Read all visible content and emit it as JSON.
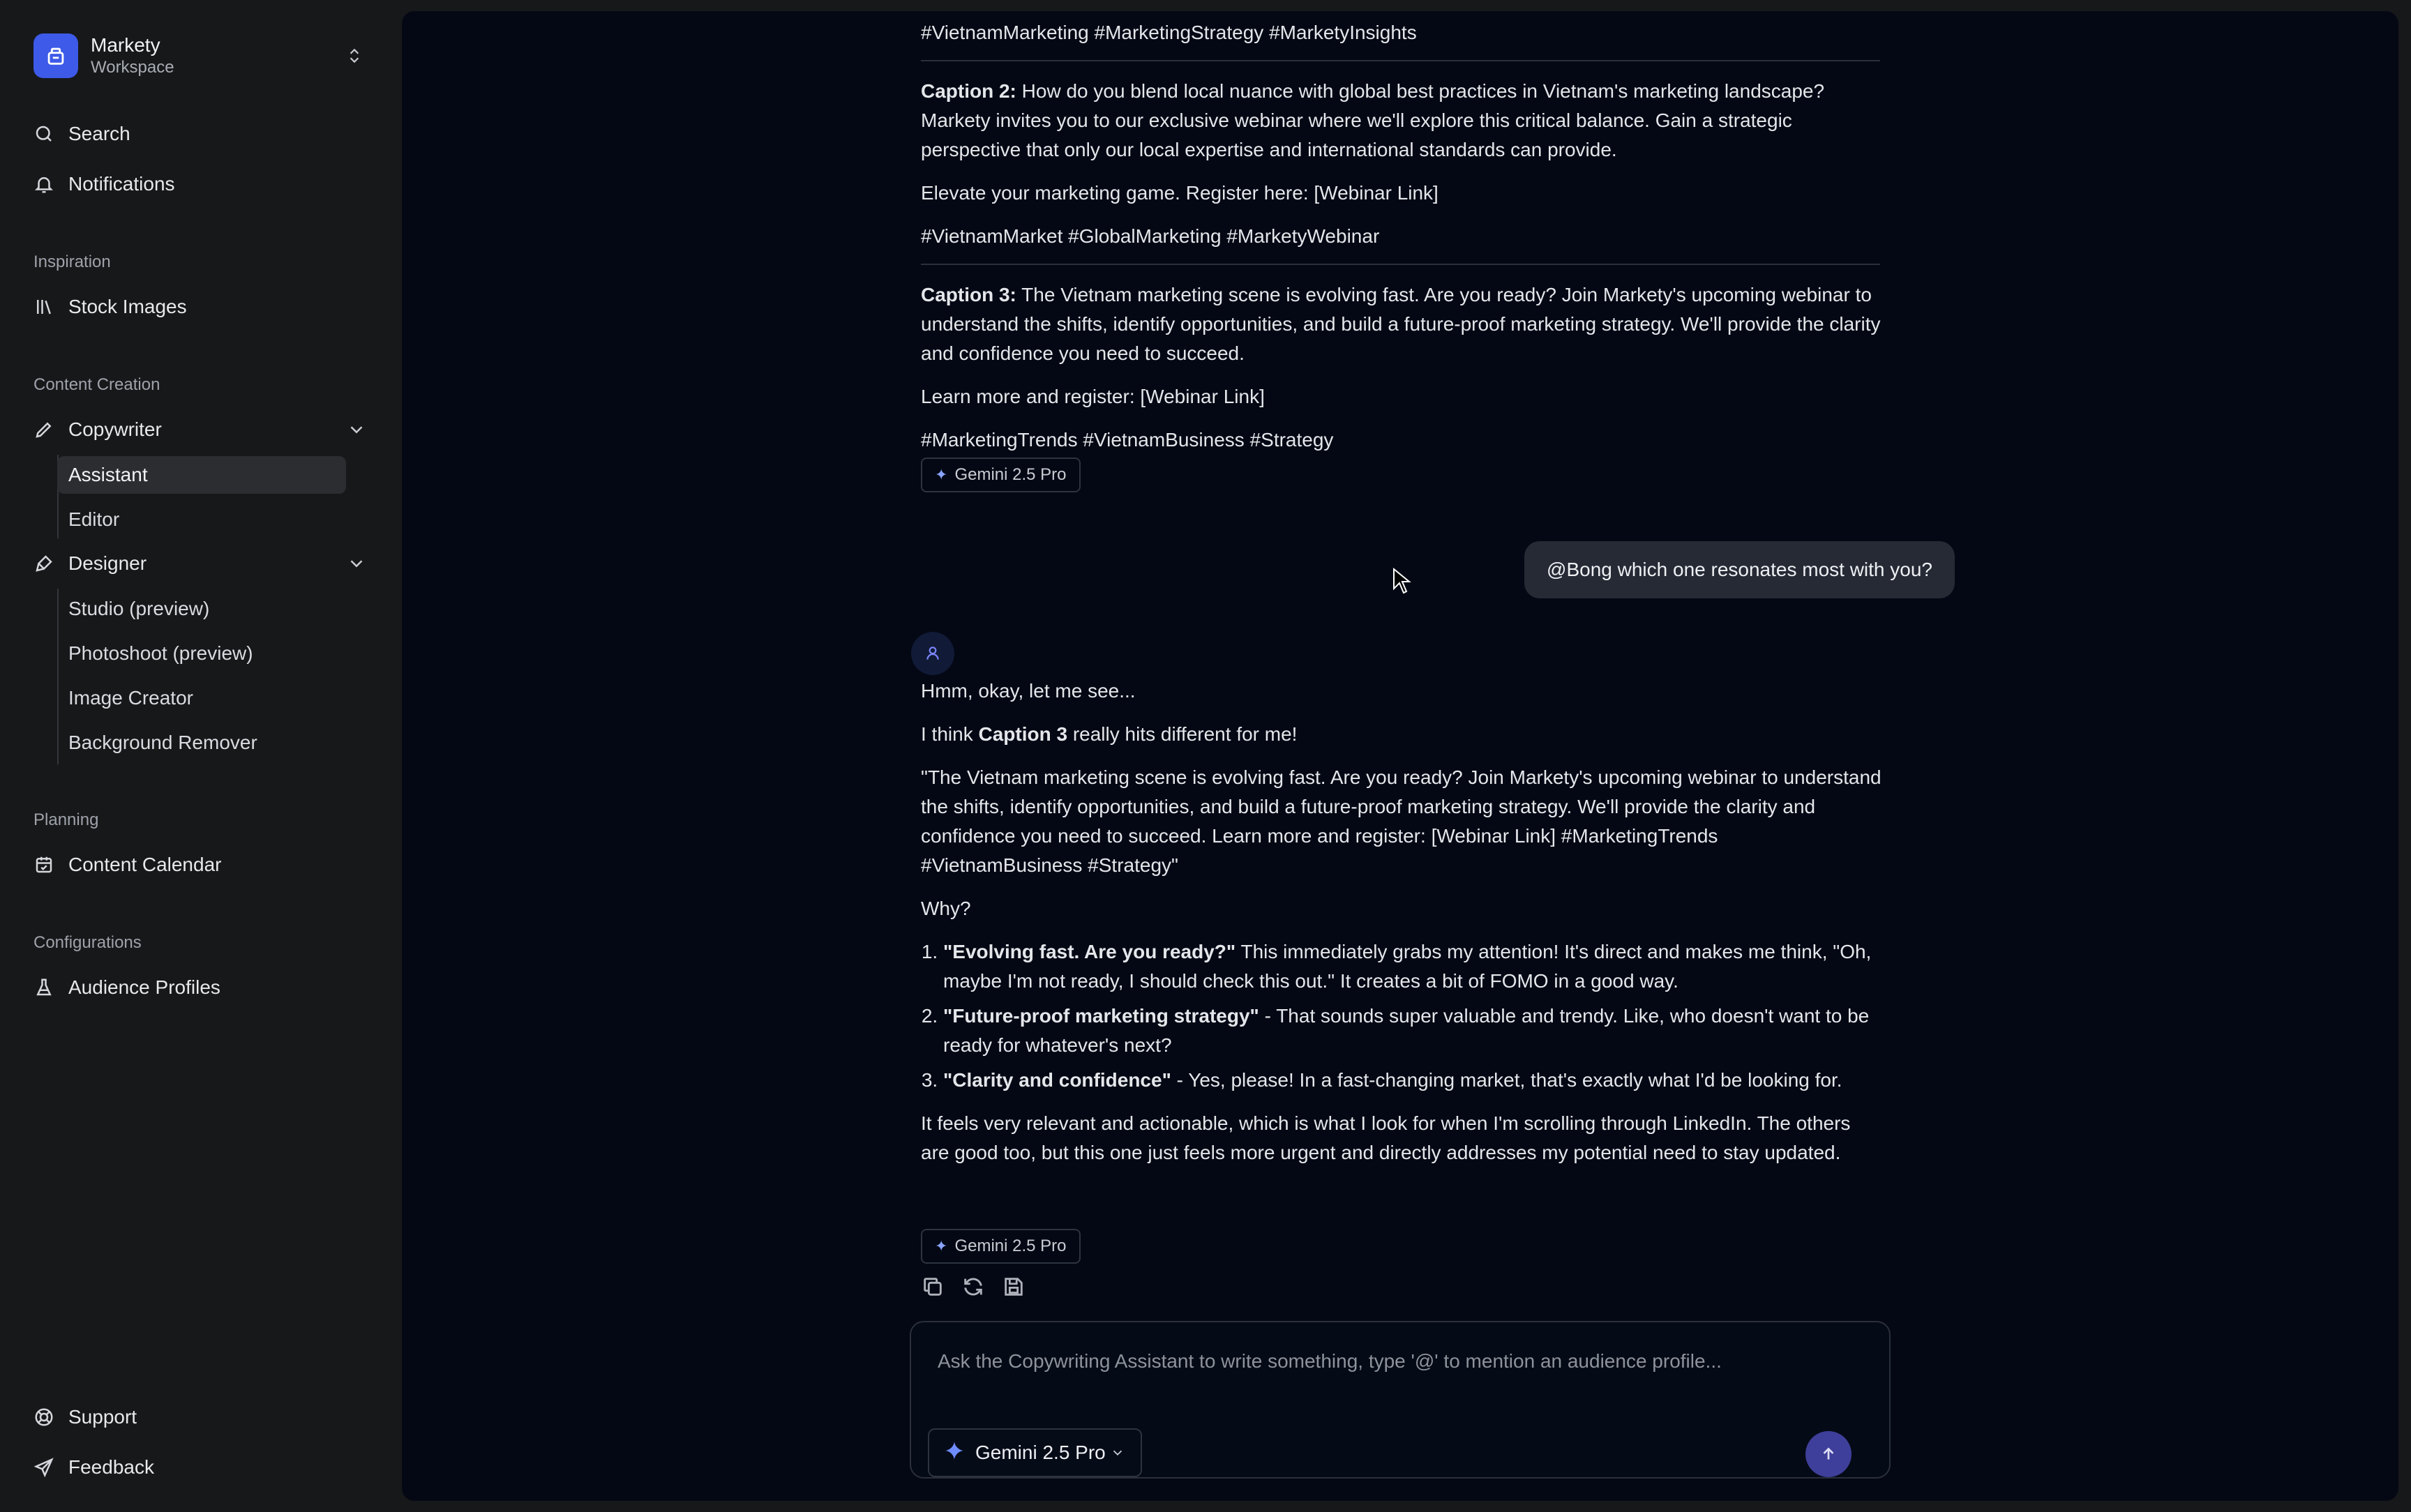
{
  "workspace": {
    "name": "Markety",
    "subtitle": "Workspace"
  },
  "nav": {
    "search": "Search",
    "notifications": "Notifications",
    "inspiration_label": "Inspiration",
    "stock_images": "Stock Images",
    "content_creation_label": "Content Creation",
    "copywriter": "Copywriter",
    "copywriter_items": [
      "Assistant",
      "Editor"
    ],
    "designer": "Designer",
    "designer_items": [
      "Studio (preview)",
      "Photoshoot (preview)",
      "Image Creator",
      "Background Remover"
    ],
    "planning_label": "Planning",
    "content_calendar": "Content Calendar",
    "configurations_label": "Configurations",
    "audience_profiles": "Audience Profiles",
    "support": "Support",
    "feedback": "Feedback"
  },
  "chat": {
    "caption1_tags": "#VietnamMarketing #MarketingStrategy #MarketyInsights",
    "caption2": {
      "label": "Caption 2:",
      "text": " How do you blend local nuance with global best practices in Vietnam's marketing landscape? Markety invites you to our exclusive webinar where we'll explore this critical balance. Gain a strategic perspective that only our local expertise and international standards can provide.",
      "cta": "Elevate your marketing game. Register here: [Webinar Link]",
      "tags": "#VietnamMarket #GlobalMarketing #MarketyWebinar"
    },
    "caption3": {
      "label": "Caption 3:",
      "text": " The Vietnam marketing scene is evolving fast. Are you ready? Join Markety's upcoming webinar to understand the shifts, identify opportunities, and build a future-proof marketing strategy. We'll provide the clarity and confidence you need to succeed.",
      "cta": "Learn more and register: [Webinar Link]",
      "tags": "#MarketingTrends #VietnamBusiness #Strategy"
    },
    "model_badge": "Gemini 2.5 Pro",
    "user_message": "@Bong which one resonates most with you?",
    "reply": {
      "intro": "Hmm, okay, let me see...",
      "pick_pre": "I think ",
      "pick_bold": "Caption 3",
      "pick_post": " really hits different for me!",
      "quote": "\"The Vietnam marketing scene is evolving fast. Are you ready? Join Markety's upcoming webinar to understand the shifts, identify opportunities, and build a future-proof marketing strategy. We'll provide the clarity and confidence you need to succeed. Learn more and register: [Webinar Link] #MarketingTrends #VietnamBusiness #Strategy\"",
      "why": "Why?",
      "reasons": [
        {
          "bold": "\"Evolving fast. Are you ready?\"",
          "text": " This immediately grabs my attention! It's direct and makes me think, \"Oh, maybe I'm not ready, I should check this out.\" It creates a bit of FOMO in a good way."
        },
        {
          "bold": "\"Future-proof marketing strategy\"",
          "text": " - That sounds super valuable and trendy. Like, who doesn't want to be ready for whatever's next?"
        },
        {
          "bold": "\"Clarity and confidence\"",
          "text": " - Yes, please! In a fast-changing market, that's exactly what I'd be looking for."
        }
      ],
      "closing": "It feels very relevant and actionable, which is what I look for when I'm scrolling through LinkedIn. The others are good too, but this one just feels more urgent and directly addresses my potential need to stay updated."
    }
  },
  "composer": {
    "placeholder": "Ask the Copywriting Assistant to write something, type '@' to mention an audience profile...",
    "model": "Gemini 2.5 Pro"
  },
  "colors": {
    "accent": "#3d5ae8",
    "send": "#3e3f9a",
    "main_bg": "#030814",
    "sidebar_bg": "#17181a"
  }
}
